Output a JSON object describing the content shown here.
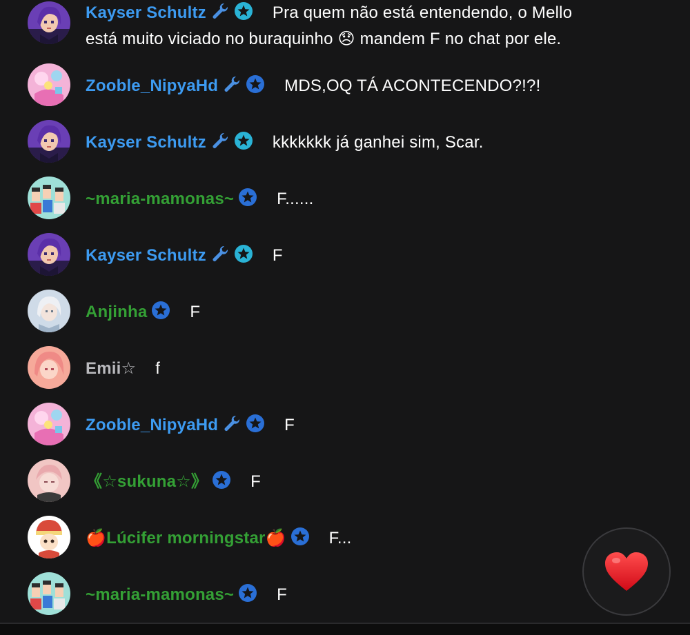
{
  "messages": [
    {
      "user": "Kayser Schultz",
      "name_color": "blue",
      "avatar": "kayser",
      "badges": [
        "wrench-icon",
        "star-badge-cyan"
      ],
      "text": "Pra quem não está entendendo, o Mello",
      "text2": "está muito viciado no buraquinho 😞 mandem F no chat por ele."
    },
    {
      "user": "Zooble_NipyaHd",
      "name_color": "blue",
      "avatar": "zooble",
      "badges": [
        "wrench-icon",
        "star-badge-blue"
      ],
      "text": "MDS,OQ TÁ ACONTECENDO?!?!"
    },
    {
      "user": "Kayser Schultz",
      "name_color": "blue",
      "avatar": "kayser",
      "badges": [
        "wrench-icon",
        "star-badge-cyan"
      ],
      "text": "kkkkkkk já ganhei sim, Scar."
    },
    {
      "user": "~maria-mamonas~",
      "name_color": "green",
      "avatar": "maria",
      "badges": [
        "star-badge-blue"
      ],
      "text": "F......"
    },
    {
      "user": "Kayser Schultz",
      "name_color": "blue",
      "avatar": "kayser",
      "badges": [
        "wrench-icon",
        "star-badge-cyan"
      ],
      "text": "F"
    },
    {
      "user": "Anjinha",
      "name_color": "green",
      "avatar": "anjinha",
      "badges": [
        "star-badge-blue"
      ],
      "text": "F"
    },
    {
      "user": "Emii☆",
      "name_color": "gray",
      "avatar": "emii",
      "badges": [],
      "text": "f"
    },
    {
      "user": "Zooble_NipyaHd",
      "name_color": "blue",
      "avatar": "zooble",
      "badges": [
        "wrench-icon",
        "star-badge-blue"
      ],
      "text": "F"
    },
    {
      "user": "《☆sukuna☆》",
      "name_color": "green",
      "avatar": "sukuna",
      "badges": [
        "star-badge-blue"
      ],
      "text": "F"
    },
    {
      "user": "🍎Lúcifer morningstar🍎",
      "name_color": "green",
      "avatar": "lucifer",
      "badges": [
        "star-badge-blue"
      ],
      "text": "F..."
    },
    {
      "user": "~maria-mamonas~",
      "name_color": "green",
      "avatar": "maria",
      "badges": [
        "star-badge-blue"
      ],
      "text": "F"
    }
  ],
  "like_button": {
    "icon": "heart-icon",
    "color": "#e8141f"
  },
  "colors": {
    "background": "#161617",
    "name_blue": "#3d9bf1",
    "name_green": "#34a035",
    "name_gray": "#b9b9bd"
  }
}
